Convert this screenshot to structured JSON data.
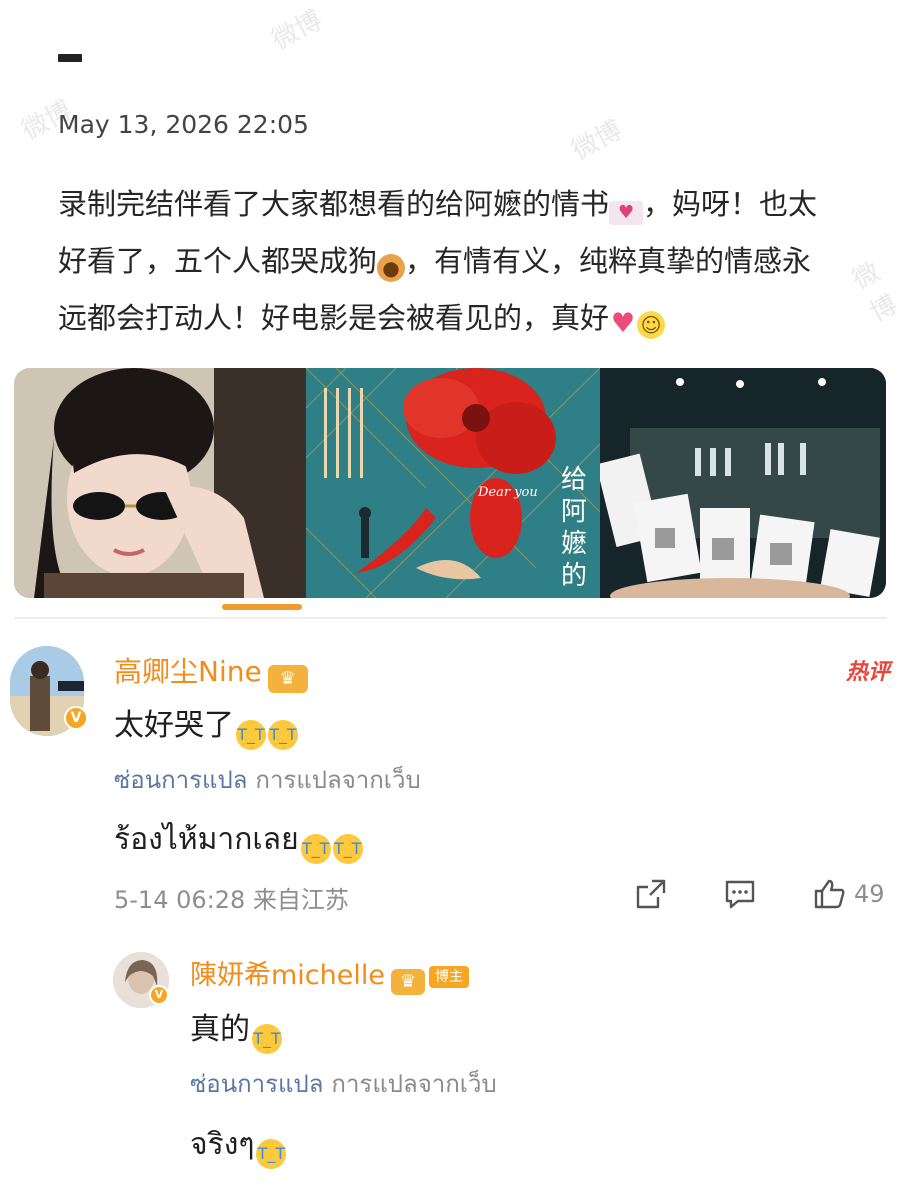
{
  "post": {
    "date": "May 13, 2026 22:05",
    "text_line1": "录制完结伴看了大家都想看的给阿嬷的情书",
    "text_line1b": "，妈呀！也太",
    "text_line2": "好看了，五个人都哭成狗",
    "text_line2b": "，有情有义，纯粹真挚的情感永",
    "text_line3": "远都会打动人！好电影是会被看见的，真好",
    "emoji_names": [
      "love-letter-icon",
      "dog-icon",
      "heart-icon",
      "smile-icon"
    ]
  },
  "gallery": {
    "poster_title": "给阿嬷的情书",
    "poster_subtitle": "Dear you",
    "image_count": 3
  },
  "comments": [
    {
      "user": "高卿尘Nine",
      "text": "太好哭了",
      "hide_translation": "ซ่อนการแปล",
      "web_translation": "การแปลจากเว็บ",
      "translated": "ร้องไห้มากเลย",
      "time": "5-14 06:28",
      "location": "来自江苏",
      "likes": "49",
      "hot_tag": "热评"
    },
    {
      "user": "陳妍希michelle",
      "blogger_badge": "博主",
      "text": "真的",
      "hide_translation": "ซ่อนการแปล",
      "web_translation": "การแปลจากเว็บ",
      "translated": "จริงๆ"
    }
  ],
  "colors": {
    "accent": "#f28c1b",
    "link": "#5a77a3",
    "meta": "#8e8e8e"
  },
  "watermark": "微博"
}
